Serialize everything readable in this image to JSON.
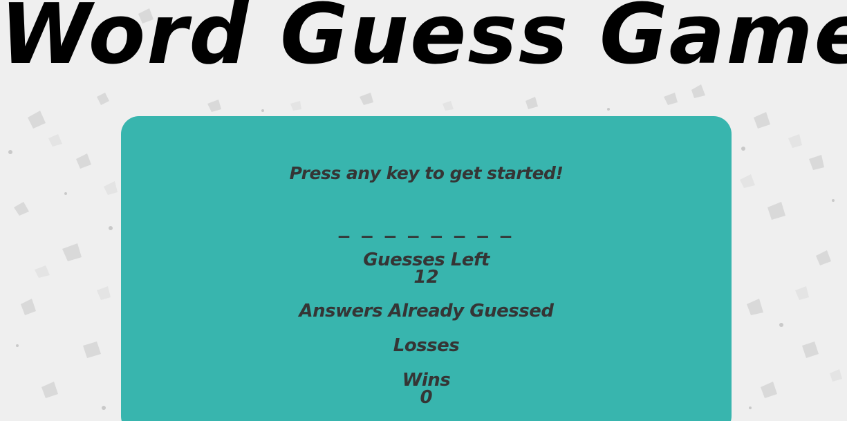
{
  "page": {
    "title": "Word Guess Game"
  },
  "game": {
    "instructions": "Press any key to get started!",
    "word_blanks": "_ _ _ _ _ _ _ _",
    "guesses_left_label": "Guesses Left",
    "guesses_left_value": "12",
    "answers_guessed_label": "Answers Already Guessed",
    "answers_guessed_value": "",
    "losses_label": "Losses",
    "losses_value": "",
    "wins_label": "Wins",
    "wins_value": "0"
  },
  "colors": {
    "background": "#efefef",
    "panel": "#38b5ae",
    "panel_text": "#353535",
    "title_text": "#000000"
  }
}
